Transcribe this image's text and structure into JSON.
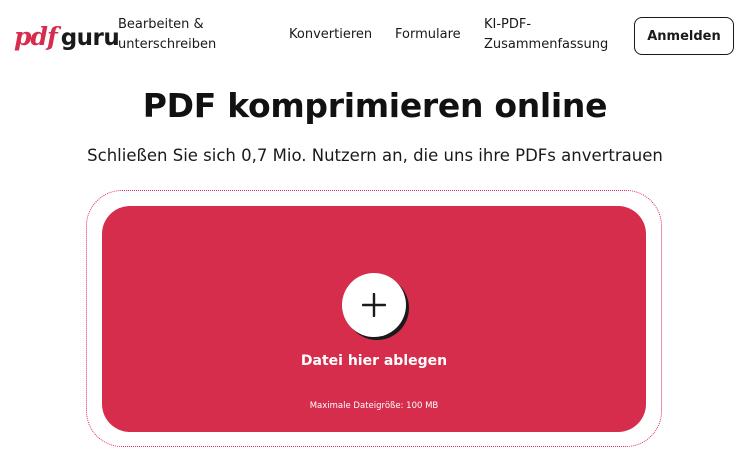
{
  "brand": {
    "logo_pdf": "pdf",
    "logo_guru": "guru",
    "accent_color": "#d62d4d"
  },
  "nav": {
    "items": [
      {
        "label": "Bearbeiten & unterschreiben"
      },
      {
        "label": "Konvertieren"
      },
      {
        "label": "Formulare"
      },
      {
        "label": "KI-PDF-Zusammenfassung"
      }
    ],
    "login_label": "Anmelden"
  },
  "hero": {
    "title": "PDF komprimieren online",
    "subtitle": "Schließen Sie sich 0,7 Mio. Nutzern an, die uns ihre PDFs anvertrauen"
  },
  "dropzone": {
    "icon": "plus-icon",
    "label": "Datei hier ablegen",
    "max_size": "Maximale Dateigröße: 100 MB"
  }
}
